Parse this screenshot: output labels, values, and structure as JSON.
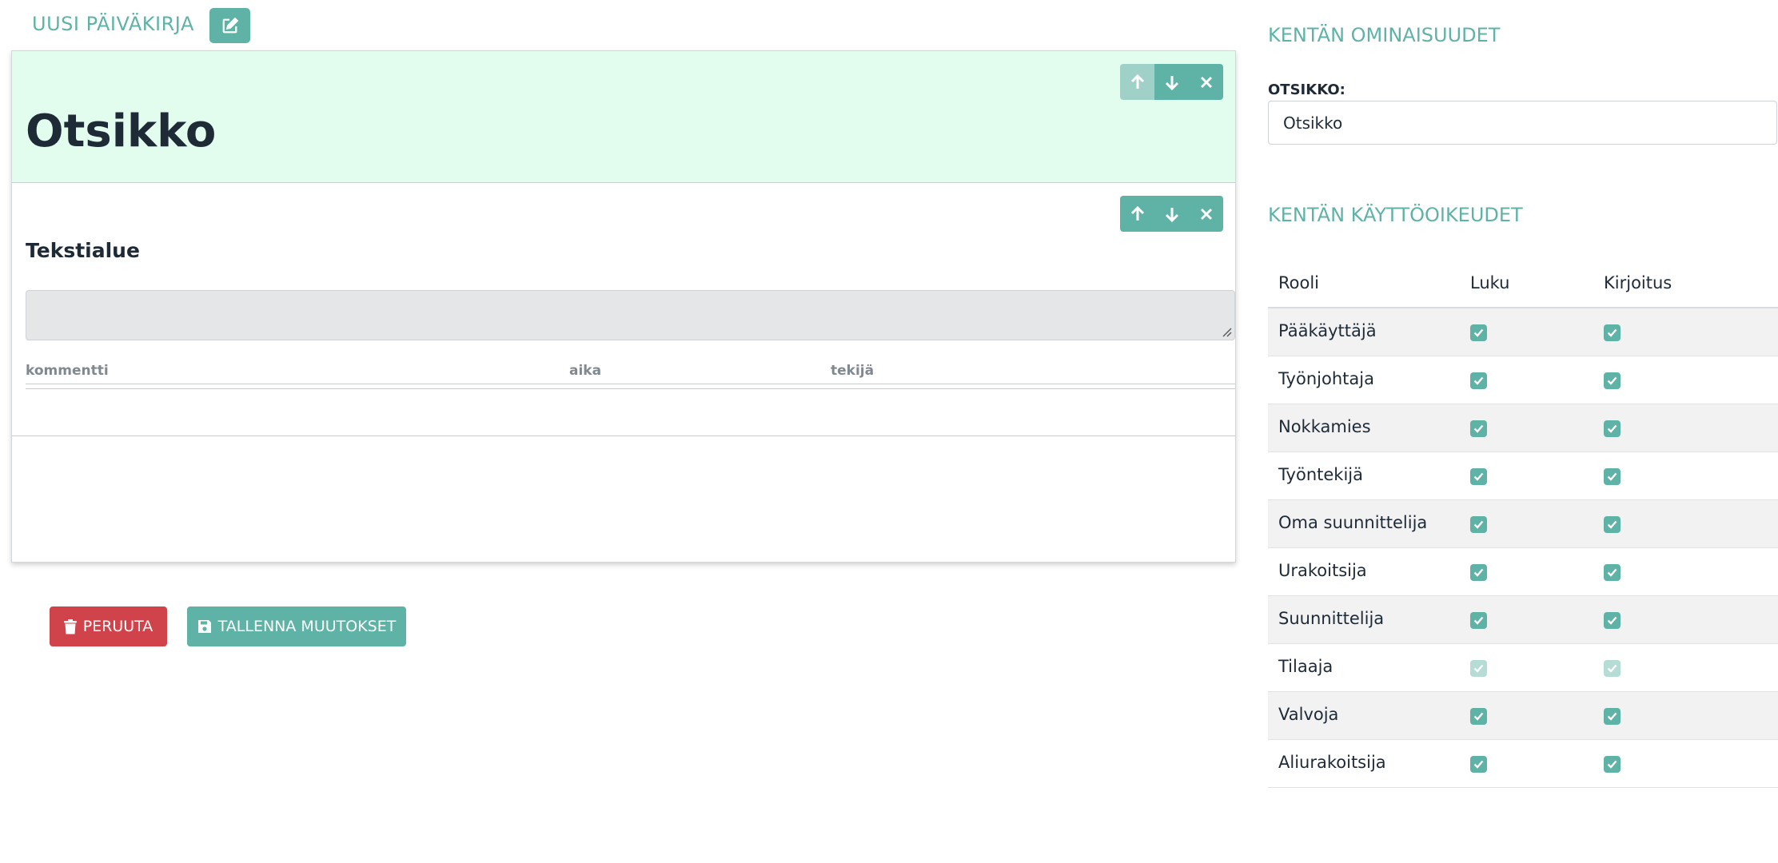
{
  "header": {
    "title": "UUSI PÄIVÄKIRJA",
    "edit_icon": "edit-icon"
  },
  "editor": {
    "title_block": {
      "text": "Otsikko"
    },
    "textarea_block": {
      "label": "Tekstialue",
      "columns": [
        "kommentti",
        "aika",
        "tekijä"
      ]
    },
    "toolbar_icons": [
      "arrow-up-icon",
      "arrow-down-icon",
      "close-icon"
    ]
  },
  "actions": {
    "cancel_label": "PERUUTA",
    "save_label": "TALLENNA MUUTOKSET"
  },
  "properties": {
    "section_title": "KENTÄN OMINAISUUDET",
    "title_label": "OTSIKKO:",
    "title_value": "Otsikko"
  },
  "permissions": {
    "section_title": "KENTÄN KÄYTTÖOIKEUDET",
    "headers": {
      "role": "Rooli",
      "read": "Luku",
      "write": "Kirjoitus"
    },
    "rows": [
      {
        "role": "Pääkäyttäjä",
        "read": true,
        "write": true,
        "disabled": false
      },
      {
        "role": "Työnjohtaja",
        "read": true,
        "write": true,
        "disabled": false
      },
      {
        "role": "Nokkamies",
        "read": true,
        "write": true,
        "disabled": false
      },
      {
        "role": "Työntekijä",
        "read": true,
        "write": true,
        "disabled": false
      },
      {
        "role": "Oma suunnittelija",
        "read": true,
        "write": true,
        "disabled": false
      },
      {
        "role": "Urakoitsija",
        "read": true,
        "write": true,
        "disabled": false
      },
      {
        "role": "Suunnittelija",
        "read": true,
        "write": true,
        "disabled": false
      },
      {
        "role": "Tilaaja",
        "read": true,
        "write": true,
        "disabled": true
      },
      {
        "role": "Valvoja",
        "read": true,
        "write": true,
        "disabled": false
      },
      {
        "role": "Aliurakoitsija",
        "read": true,
        "write": true,
        "disabled": false
      }
    ]
  },
  "colors": {
    "accent": "#5fb3a6",
    "danger": "#d1434b",
    "title_bg": "#e2fcee"
  }
}
